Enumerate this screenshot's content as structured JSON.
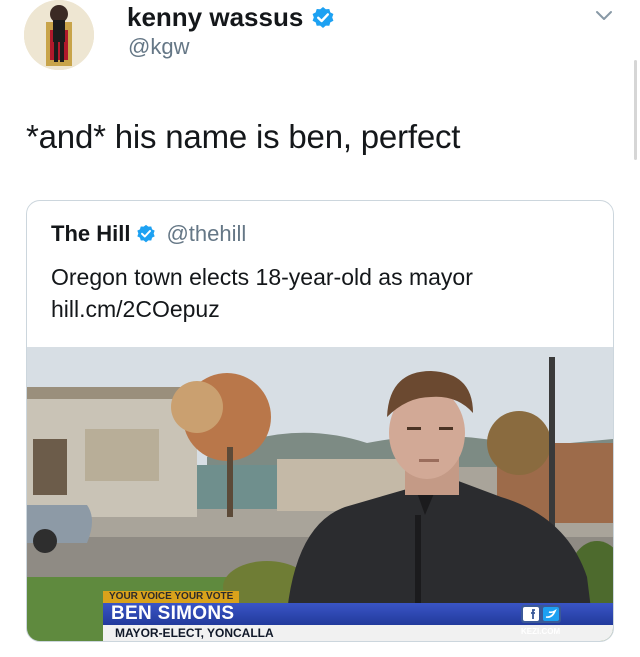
{
  "author": {
    "name": "kenny wassus",
    "handle": "@kgw",
    "verified": true
  },
  "tweet": {
    "text": "*and* his name is ben, perfect"
  },
  "quoted_tweet": {
    "name": "The Hill",
    "handle": "@thehill",
    "verified": true,
    "text": "Oregon town elects 18-year-old as mayor",
    "link": "hill.cm/2COepuz"
  },
  "news_graphic": {
    "tag": "YOUR VOICE YOUR VOTE",
    "name": "BEN SIMONS",
    "title": "MAYOR-ELECT, YONCALLA",
    "brand": "KEZI.COM"
  },
  "colors": {
    "verified_badge": "#1da1f2",
    "handle_gray": "#657786",
    "card_border": "#ccd6dd",
    "lower_third_blue": "#2d48b4",
    "lower_third_gold": "#d9a21b"
  },
  "icons": {
    "verified": "verified-badge-icon",
    "menu": "chevron-down-icon"
  }
}
